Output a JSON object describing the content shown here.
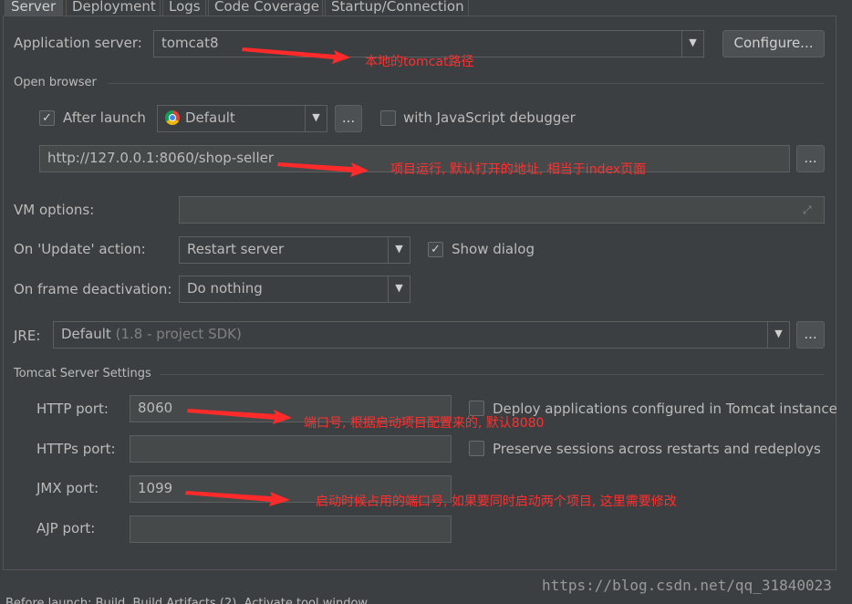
{
  "tabs": [
    "Server",
    "Deployment",
    "Logs",
    "Code Coverage",
    "Startup/Connection"
  ],
  "app_server": {
    "label": "Application server:",
    "value": "tomcat8",
    "configure_label": "Configure..."
  },
  "open_browser": {
    "section_title": "Open browser",
    "after_launch_label": "After launch",
    "after_launch_checked": true,
    "browser_value": "Default",
    "browser_icon": "chrome-icon",
    "more_label": "...",
    "js_debugger_label": "with JavaScript debugger",
    "js_debugger_checked": false,
    "url": "http://127.0.0.1:8060/shop-seller",
    "url_more_label": "..."
  },
  "vm_options": {
    "label": "VM options:",
    "value": ""
  },
  "update_action": {
    "label": "On 'Update' action:",
    "value": "Restart server",
    "show_dialog_label": "Show dialog",
    "show_dialog_checked": true
  },
  "frame_deactivation": {
    "label": "On frame deactivation:",
    "value": "Do nothing"
  },
  "jre": {
    "label": "JRE:",
    "value": "Default",
    "hint": "(1.8 - project SDK)",
    "more_label": "..."
  },
  "tomcat": {
    "section_title": "Tomcat Server Settings",
    "http_label": "HTTP port:",
    "http_value": "8060",
    "https_label": "HTTPs port:",
    "https_value": "",
    "jmx_label": "JMX port:",
    "jmx_value": "1099",
    "ajp_label": "AJP port:",
    "ajp_value": "",
    "deploy_label": "Deploy applications configured in Tomcat instance",
    "deploy_checked": false,
    "preserve_label": "Preserve sessions across restarts and redeploys",
    "preserve_checked": false
  },
  "annotations": {
    "tomcat_path": "本地的tomcat路径",
    "url_note": "项目运行, 默认打开的地址, 相当于index页面",
    "http_note": "端口号, 根据启动项目配置来的, 默认8080",
    "jmx_note": "启动时候占用的端口号, 如果要同时启动两个项目, 这里需要修改"
  },
  "watermark": "https://blog.csdn.net/qq_31840023",
  "bottom_bar": "Before launch: Build, Build Artifacts (2), Activate tool window",
  "colors": {
    "annotation": "#ff3030",
    "background": "#3c3f41"
  }
}
